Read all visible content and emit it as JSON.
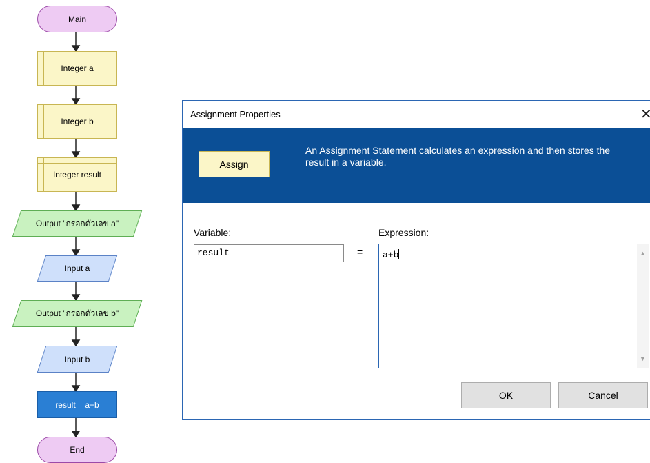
{
  "flowchart": {
    "nodes": [
      {
        "label": "Main",
        "kind": "terminal"
      },
      {
        "label": "Integer a",
        "kind": "declare"
      },
      {
        "label": "Integer b",
        "kind": "declare"
      },
      {
        "label": "Integer result",
        "kind": "declare"
      },
      {
        "label": "Output \"กรอกตัวเลข a\"",
        "kind": "output"
      },
      {
        "label": "Input a",
        "kind": "input"
      },
      {
        "label": "Output \"กรอกตัวเลข b\"",
        "kind": "output"
      },
      {
        "label": "Input b",
        "kind": "input"
      },
      {
        "label": "result = a+b",
        "kind": "assign"
      },
      {
        "label": "End",
        "kind": "terminal"
      }
    ]
  },
  "dialog": {
    "title": "Assignment Properties",
    "close_glyph": "✕",
    "banner": {
      "badge": "Assign",
      "description": "An Assignment Statement calculates an expression and then stores the result in a variable."
    },
    "variable_label": "Variable:",
    "variable_value": "result",
    "equals": "=",
    "expression_label": "Expression:",
    "expression_value": "a+b",
    "ok_label": "OK",
    "cancel_label": "Cancel"
  },
  "colors": {
    "banner": "#0b4f96",
    "terminal": "#eecbf3",
    "declare": "#fbf6c8",
    "output": "#c9f2c0",
    "input": "#cfe0fb",
    "assign": "#2a7fd4"
  }
}
